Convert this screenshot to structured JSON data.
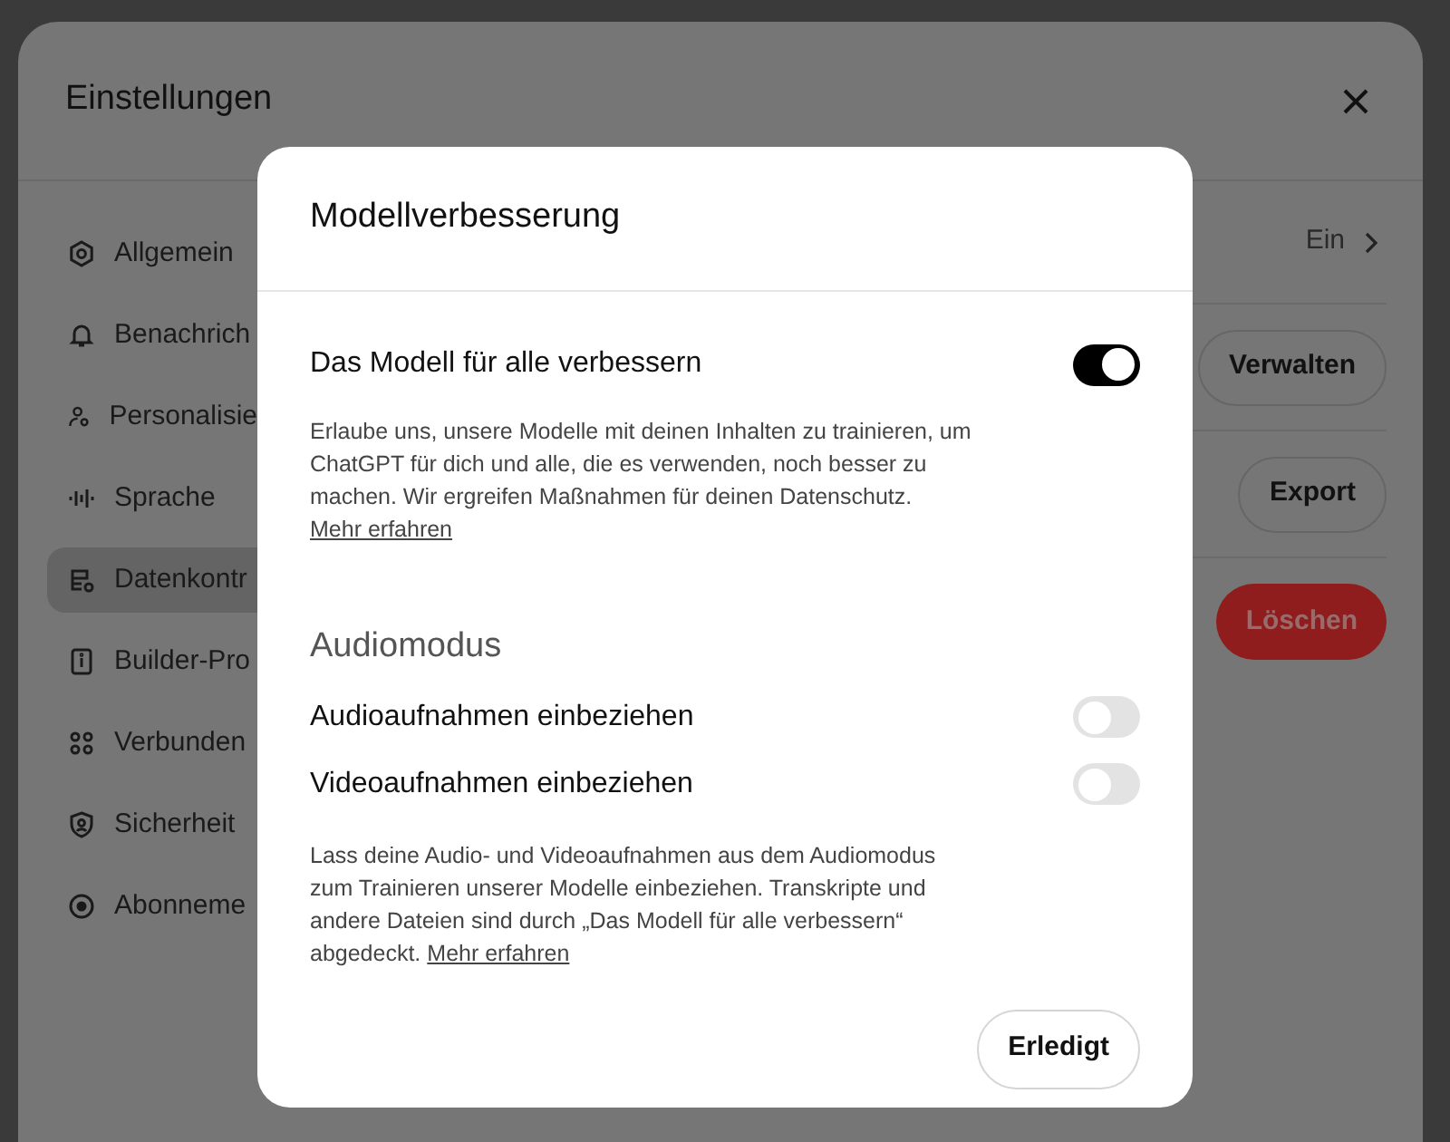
{
  "settings": {
    "title": "Einstellungen",
    "sidebar": {
      "items": [
        {
          "label": "Allgemein",
          "selected": false
        },
        {
          "label": "Benachrich",
          "selected": false
        },
        {
          "label": "Personalisie",
          "selected": false
        },
        {
          "label": "Sprache",
          "selected": false
        },
        {
          "label": "Datenkontr",
          "selected": true
        },
        {
          "label": "Builder-Pro",
          "selected": false
        },
        {
          "label": "Verbunden",
          "selected": false
        },
        {
          "label": "Sicherheit",
          "selected": false
        },
        {
          "label": "Abonneme",
          "selected": false
        }
      ]
    },
    "rows": [
      {
        "kind": "value",
        "value": "Ein"
      },
      {
        "kind": "button",
        "label": "Verwalten"
      },
      {
        "kind": "button",
        "label": "Export"
      },
      {
        "kind": "danger",
        "label": "Löschen"
      }
    ]
  },
  "dialog": {
    "title": "Modellverbesserung",
    "main_toggle": {
      "label": "Das Modell für alle verbessern",
      "on": true
    },
    "main_description": "Erlaube uns, unsere Modelle mit deinen Inhalten zu trainieren, um ChatGPT für dich und alle, die es verwenden, noch besser zu machen. Wir ergreifen Maßnahmen für deinen Datenschutz.",
    "main_link": "Mehr erfahren",
    "section_title": "Audiomodus",
    "toggles": [
      {
        "label": "Audioaufnahmen einbeziehen",
        "on": false
      },
      {
        "label": "Videoaufnahmen einbeziehen",
        "on": false
      }
    ],
    "section_description": "Lass deine Audio- und Videoaufnahmen aus dem Audiomodus zum Trainieren unserer Modelle einbeziehen. Transkripte und andere Dateien sind durch „Das Modell für alle verbessern“ abgedeckt.",
    "section_link": "Mehr erfahren",
    "done_button": "Erledigt"
  }
}
